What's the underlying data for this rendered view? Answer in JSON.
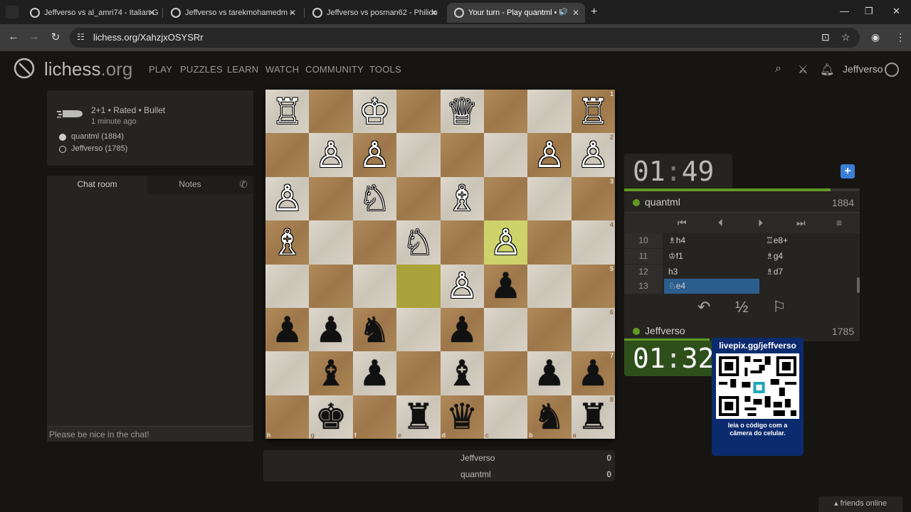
{
  "browser": {
    "tabs": [
      {
        "title": "Jeffverso vs al_amri74 - Italian G"
      },
      {
        "title": "Jeffverso vs tarekmohamedm -"
      },
      {
        "title": "Jeffverso vs posman62 - Philido"
      },
      {
        "title": "Your turn - Play quantml • li"
      }
    ],
    "url": "lichess.org/XahzjxOSYSRr",
    "icons": {
      "menu": "chevron-down-icon",
      "new_tab": "+",
      "minimize": "—",
      "maximize": "❐",
      "close": "✕",
      "back": "←",
      "forward": "→",
      "reload": "↻",
      "tune": "☷",
      "install": "⊡",
      "bookmark": "☆",
      "profile": "◉",
      "more": "⋮",
      "speaker": "🔊"
    }
  },
  "site": {
    "logo_main": "lichess",
    "logo_tld": ".org",
    "nav": [
      "PLAY",
      "PUZZLES",
      "LEARN",
      "WATCH",
      "COMMUNITY",
      "TOOLS"
    ],
    "username": "Jeffverso"
  },
  "game": {
    "setup": "2+1 • Rated • Bullet",
    "ago": "1 minute ago",
    "white_player": "quantml (1884)",
    "black_player": "Jeffverso (1785)"
  },
  "chat": {
    "tab_chat": "Chat room",
    "tab_notes": "Notes",
    "placeholder": "Please be nice in the chat!"
  },
  "board": {
    "rank_labels": [
      "1",
      "2",
      "3",
      "4",
      "5",
      "6",
      "7",
      "8"
    ],
    "file_labels": [
      "h",
      "g",
      "f",
      "e",
      "d",
      "c",
      "b",
      "a"
    ],
    "highlight": [
      "3-5",
      "4-3"
    ],
    "squares": [
      [
        "♖w",
        "",
        "♔w",
        "",
        "♕w",
        "",
        "",
        "♖w"
      ],
      [
        "",
        "♙w",
        "♙w",
        "",
        "",
        "",
        "♙w",
        "♙w"
      ],
      [
        "♙w",
        "",
        "♘w",
        "",
        "♗w",
        "",
        "",
        ""
      ],
      [
        "♗w",
        "",
        "",
        "♘w",
        "",
        "♙w",
        "",
        ""
      ],
      [
        "",
        "",
        "",
        "",
        "♙w",
        "♟b",
        "",
        ""
      ],
      [
        "♟b",
        "♟b",
        "♞b",
        "",
        "♟b",
        "",
        "",
        ""
      ],
      [
        "",
        "♝b",
        "♟b",
        "",
        "♝b",
        "",
        "♟b",
        "♟b"
      ],
      [
        "",
        "♚b",
        "",
        "♜b",
        "♛b",
        "",
        "♞b",
        "♜b"
      ]
    ]
  },
  "score": {
    "rows": [
      {
        "name": "Jeffverso",
        "value": "0"
      },
      {
        "name": "quantml",
        "value": "0"
      }
    ]
  },
  "clocks": {
    "top": {
      "min": "01",
      "sec": "49"
    },
    "bottom": {
      "min": "01",
      "sec": "32"
    }
  },
  "players": {
    "top": {
      "name": "quantml",
      "rating": "1884"
    },
    "bottom": {
      "name": "Jeffverso",
      "rating": "1785"
    }
  },
  "moves": [
    {
      "num": "10",
      "white": "♗h4",
      "black": "♖e8+"
    },
    {
      "num": "11",
      "white": "♔f1",
      "black": "♗g4"
    },
    {
      "num": "12",
      "white": "h3",
      "black": "♗d7"
    },
    {
      "num": "13",
      "white": "♘e4",
      "black": ""
    }
  ],
  "controls": {
    "first": "⏮",
    "prev": "⏴",
    "next": "⏵",
    "last": "⏭",
    "menu": "≡"
  },
  "actions": {
    "takeback": "↶",
    "draw": "½",
    "resign": "⚐"
  },
  "qr": {
    "title": "livepix.gg/jeffverso",
    "caption_1": "leia o código com a",
    "caption_2": "câmera do celular."
  },
  "friends": "▴ friends online",
  "colors": {
    "accent_green": "#629924",
    "board_light": "#d8d2c6",
    "board_dark": "#a5804f",
    "highlight": "#cdd26a",
    "move_active": "#2b5e8c"
  }
}
